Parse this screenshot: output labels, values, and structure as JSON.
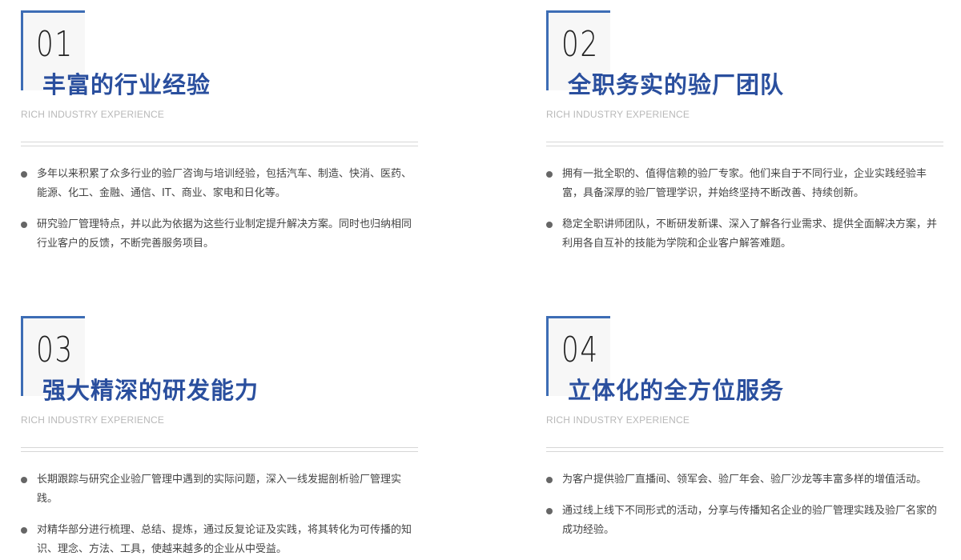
{
  "sections": [
    {
      "number": "01",
      "title": "丰富的行业经验",
      "subtitle": "RICH INDUSTRY EXPERIENCE",
      "items": [
        "多年以来积累了众多行业的验厂咨询与培训经验，包括汽车、制造、快消、医药、能源、化工、金融、通信、IT、商业、家电和日化等。",
        "研究验厂管理特点，并以此为依据为这些行业制定提升解决方案。同时也归纳相同行业客户的反馈，不断完善服务项目。"
      ]
    },
    {
      "number": "02",
      "title": "全职务实的验厂团队",
      "subtitle": "RICH INDUSTRY EXPERIENCE",
      "items": [
        "拥有一批全职的、值得信赖的验厂专家。他们来自于不同行业，企业实践经验丰富，具备深厚的验厂管理学识，并始终坚持不断改善、持续创新。",
        "稳定全职讲师团队，不断研发新课、深入了解各行业需求、提供全面解决方案，并利用各自互补的技能为学院和企业客户解答难题。"
      ]
    },
    {
      "number": "03",
      "title": "强大精深的研发能力",
      "subtitle": "RICH INDUSTRY EXPERIENCE",
      "items": [
        "长期跟踪与研究企业验厂管理中遇到的实际问题，深入一线发掘剖析验厂管理实践。",
        "对精华部分进行梳理、总结、提炼，通过反复论证及实践，将其转化为可传播的知识、理念、方法、工具，使越来越多的企业从中受益。"
      ]
    },
    {
      "number": "04",
      "title": "立体化的全方位服务",
      "subtitle": "RICH INDUSTRY EXPERIENCE",
      "items": [
        "为客户提供验厂直播间、领军会、验厂年会、验厂沙龙等丰富多样的增值活动。",
        "通过线上线下不同形式的活动，分享与传播知名企业的验厂管理实践及验厂名家的成功经验。"
      ]
    }
  ],
  "colors": {
    "accent": "#3d6db5",
    "title": "#2a4f9e",
    "subtitle": "#b8b8b8",
    "text": "#444444",
    "bullet": "#666666"
  }
}
